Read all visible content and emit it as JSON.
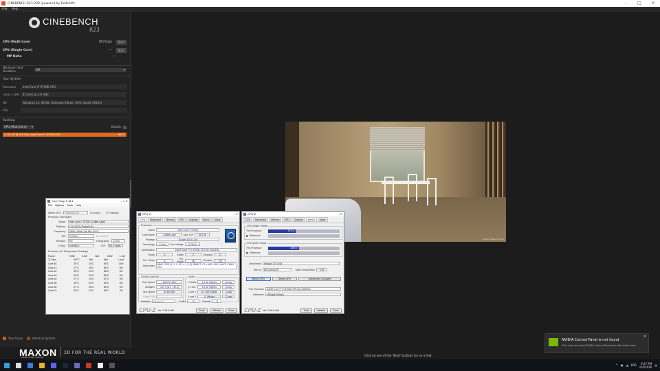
{
  "window": {
    "title": "CINEBENCH R23.200 (powered by Redshift)"
  },
  "menu": {
    "file": "File",
    "help": "Help"
  },
  "brand": {
    "name": "CINEBENCH",
    "version": "R23"
  },
  "tests": {
    "multi": {
      "label": "CPU (Multi Core)",
      "score": "9573 pts",
      "button": "Start"
    },
    "single": {
      "label": "CPU (Single Core)",
      "score": "---",
      "button": "Start"
    },
    "mp_ratio": {
      "label": "MP Ratio",
      "value": "---"
    }
  },
  "min_duration": {
    "label": "Minimum Test Duration",
    "value": "Off"
  },
  "system": {
    "title": "Your System",
    "processor": {
      "key": "Processor",
      "value": "Intel Core i7-9700K CPU"
    },
    "cores": {
      "key": "Cores x GHz",
      "value": "8 Cores @ 3.6 GHz"
    },
    "os": {
      "key": "OS",
      "value": "Windows 10, 64 Bit, Unknown Edition (191) (build 19044)"
    },
    "info": {
      "key": "Info",
      "value": ""
    }
  },
  "ranking": {
    "title": "Ranking",
    "select": "CPU (Multi Core)",
    "details": "Details",
    "entry": "1. 8C, 8T @ 3.6 GHz, Intel Core i7-9700K CPU",
    "entry_score": "9573"
  },
  "legend": {
    "your_score": "Your Score",
    "identical": "Identical System"
  },
  "colors": {
    "accent": "#e06a1e",
    "legend_your": "#c85a1a",
    "legend_ident": "#8a4a2a"
  },
  "render": {
    "watermark": "www.cinebench.com"
  },
  "coretemp": {
    "title": "Core Temp 1.18.1",
    "menu": [
      "File",
      "Options",
      "Tools",
      "Help"
    ],
    "select_cpu": "Select CPU:",
    "processor_sel": "Processor #0",
    "cores_label": "8  Core(s)",
    "threads_label": "8  Thread(s)",
    "proc_info": "Processor Information",
    "model": {
      "k": "Model:",
      "v": "Intel Core i7 9700K (Coffee Lake)"
    },
    "platform": {
      "k": "Platform:",
      "v": "LGA 1151 (Socket H4)"
    },
    "frequency": {
      "k": "Frequency:",
      "v": "3599.14MHz (99.98 x 36.0)"
    },
    "vid": {
      "k": "VID:",
      "v": "1.0134 v",
      "k2": "Modulation:"
    },
    "revision": {
      "k": "Revision:",
      "v": "R0",
      "k2": "Lithography:",
      "v2": "14 nm"
    },
    "cpuid": {
      "k": "CPUID:",
      "v": "0x906ED",
      "k2": "TDP:",
      "v2": "95.0 Watts"
    },
    "readings_title": "Processor #0: Temperature Readings",
    "power": {
      "k": "Power:",
      "a": "9.5W",
      "b": "6.0W",
      "c": "N/A",
      "d": "3.6W",
      "e": "1.1W"
    },
    "tjmax": {
      "k": "Tj. Max:",
      "a": "100°C",
      "b": "Min.",
      "c": "Max.",
      "d": "Load"
    },
    "cores": [
      {
        "k": "Core #0:",
        "a": "26°C",
        "b": "24°C",
        "c": "56°C",
        "d": "14%"
      },
      {
        "k": "Core #1:",
        "a": "27°C",
        "b": "25°C",
        "c": "56°C",
        "d": "5%"
      },
      {
        "k": "Core #2:",
        "a": "25°C",
        "b": "23°C",
        "c": "58°C",
        "d": "5%"
      },
      {
        "k": "Core #3:",
        "a": "26°C",
        "b": "24°C",
        "c": "56°C",
        "d": "0%"
      },
      {
        "k": "Core #4:",
        "a": "27°C",
        "b": "24°C",
        "c": "57°C",
        "d": "0%"
      },
      {
        "k": "Core #5:",
        "a": "26°C",
        "b": "24°C",
        "c": "59°C",
        "d": "0%"
      },
      {
        "k": "Core #6:",
        "a": "27°C",
        "b": "25°C",
        "c": "55°C",
        "d": "0%"
      },
      {
        "k": "Core #7:",
        "a": "26°C",
        "b": "24°C",
        "c": "56°C",
        "d": "2%"
      }
    ]
  },
  "cpuz1": {
    "title": "CPU-Z",
    "tabs": [
      "CPU",
      "Mainboard",
      "Memory",
      "SPD",
      "Graphics",
      "Bench",
      "About"
    ],
    "processor": "Processor",
    "name": {
      "k": "Name",
      "v": "Intel Core i7 9700K"
    },
    "codename": {
      "k": "Code Name",
      "v": "Coffee Lake",
      "k2": "Max TDP",
      "v2": "95.0 W"
    },
    "package": {
      "k": "Package",
      "v": "Socket 1151 LGA"
    },
    "technology": {
      "k": "Technology",
      "v": "14 nm",
      "k2": "Core Voltage",
      "v2": "0.764 V"
    },
    "spec": {
      "k": "Specification",
      "v": "Intel® Core™ i7-9700K CPU @ 3.60GHz"
    },
    "family": {
      "k": "Family",
      "v": "6",
      "k2": "Model",
      "v2": "E",
      "k3": "Stepping",
      "v3": "D"
    },
    "extfamily": {
      "k": "Ext. Family",
      "v": "6",
      "k2": "Ext. Model",
      "v2": "9E",
      "k3": "Revision",
      "v3": "R0"
    },
    "instructions": {
      "k": "Instructions",
      "v": "MMX, SSE (1, 2, 3, 3S, 4.1, 4.2), EM64T, VT-x, AES, AVX, AVX2, FMA3, TSX"
    },
    "clocks_title": "Clocks (Core #0)",
    "cache_title": "Cache",
    "core_speed": {
      "k": "Core Speed",
      "v": "4690.57 MHz"
    },
    "multiplier": {
      "k": "Multiplier",
      "v": "x47.0 (8.0 - 49.0)"
    },
    "bus_speed": {
      "k": "Bus Speed",
      "v": "99.80 MHz"
    },
    "rated_fsb": {
      "k": "Rated FSB",
      "v": ""
    },
    "l1d": {
      "k": "L1 Data",
      "v": "8 x 32 KBytes",
      "w": "8-way"
    },
    "l1i": {
      "k": "L1 Inst.",
      "v": "8 x 32 KBytes",
      "w": "8-way"
    },
    "l2": {
      "k": "Level 2",
      "v": "8 x 256 KBytes",
      "w": "4-way"
    },
    "l3": {
      "k": "Level 3",
      "v": "12 MBytes",
      "w": "12-way"
    },
    "selection": {
      "k": "Selection",
      "v": "Socket #1",
      "k2": "Cores",
      "v2": "8",
      "k3": "Threads",
      "v3": "8"
    },
    "footer": {
      "logo": "CPU-Z",
      "ver": "Ver. 2.16.0.x64",
      "tools": "Tools",
      "validate": "Validate",
      "close": "Close"
    }
  },
  "cpuz2": {
    "title": "CPU-Z",
    "tabs": [
      "CPU",
      "Mainboard",
      "Memory",
      "SPD",
      "Graphics",
      "Bench",
      "About"
    ],
    "single_title": "CPU Single Thread",
    "multi_title": "CPU Multi Thread",
    "this_processor": "This Processor",
    "reference": "Reference",
    "single_value": "574.8",
    "single_fraction": 0.38,
    "multi_value": "3865.0",
    "multi_fraction": 0.43,
    "benchmark": {
      "k": "Benchmark",
      "v": "Version 17.01.64"
    },
    "run_on": {
      "k": "Run on",
      "v": "All Cores (8T)"
    },
    "mt_ratio": {
      "k": "Multi Thread Ratio",
      "v": "6.86"
    },
    "bench_cpu": "Bench CPU",
    "stress_cpu": "Stress CPU",
    "submit": "Submit and Compare",
    "this_proc_v": "Intel® Core™ i7-9700K CPU @ 3.60GHz",
    "ref_select": "<Please Select>",
    "footer": {
      "logo": "CPU-Z",
      "ver": "Ver. 2.16.0.x64",
      "tools": "Tools",
      "validate": "Validate",
      "close": "Close"
    }
  },
  "footer": {
    "maxon": "MAXON",
    "maxon_sub": "A NEMETSCHEK COMPANY",
    "tagline": "3D FOR THE REAL WORLD",
    "hint": "Click on one of the 'Start' buttons to run a test."
  },
  "toast": {
    "title": "NVIDIA Control Panel is not found",
    "body": "Click here to install NVIDIA Control Panel from Microsoft store."
  },
  "tray": {
    "lang": "ENG",
    "time": "9:27 PM",
    "date": "6/4/2026"
  }
}
